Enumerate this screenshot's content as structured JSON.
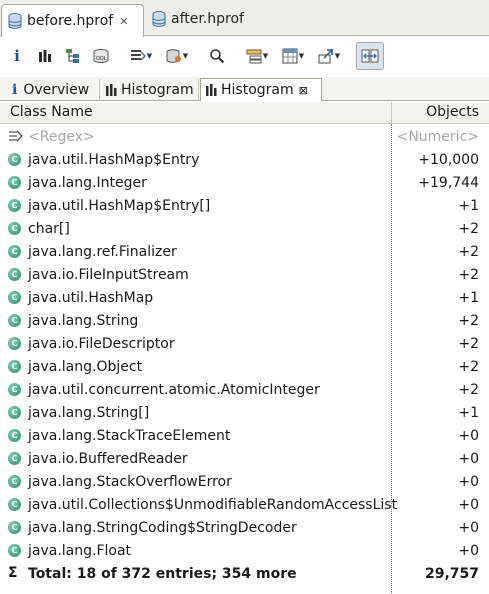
{
  "editor_tabs": [
    {
      "label": "before.hprof",
      "active": true
    },
    {
      "label": "after.hprof",
      "active": false
    }
  ],
  "inner_tabs": [
    {
      "label": "Overview"
    },
    {
      "label": "Histogram"
    },
    {
      "label": "Histogram"
    }
  ],
  "table": {
    "col_class": "Class Name",
    "col_objects": "Objects",
    "filter": {
      "name": "<Regex>",
      "value": "<Numeric>"
    },
    "rows": [
      {
        "name": "java.util.HashMap$Entry",
        "value": "+10,000"
      },
      {
        "name": "java.lang.Integer",
        "value": "+19,744"
      },
      {
        "name": "java.util.HashMap$Entry[]",
        "value": "+1"
      },
      {
        "name": "char[]",
        "value": "+2"
      },
      {
        "name": "java.lang.ref.Finalizer",
        "value": "+2"
      },
      {
        "name": "java.io.FileInputStream",
        "value": "+2"
      },
      {
        "name": "java.util.HashMap",
        "value": "+1"
      },
      {
        "name": "java.lang.String",
        "value": "+2"
      },
      {
        "name": "java.io.FileDescriptor",
        "value": "+2"
      },
      {
        "name": "java.lang.Object",
        "value": "+2"
      },
      {
        "name": "java.util.concurrent.atomic.AtomicInteger",
        "value": "+2"
      },
      {
        "name": "java.lang.String[]",
        "value": "+1"
      },
      {
        "name": "java.lang.StackTraceElement",
        "value": "+0"
      },
      {
        "name": "java.io.BufferedReader",
        "value": "+0"
      },
      {
        "name": "java.lang.StackOverflowError",
        "value": "+0"
      },
      {
        "name": "java.util.Collections$UnmodifiableRandomAccessList",
        "value": "+0"
      },
      {
        "name": "java.lang.StringCoding$StringDecoder",
        "value": "+0"
      },
      {
        "name": "java.lang.Float",
        "value": "+0"
      }
    ],
    "total": {
      "name": "Total: 18 of 372 entries; 354 more",
      "value": "29,757"
    }
  }
}
